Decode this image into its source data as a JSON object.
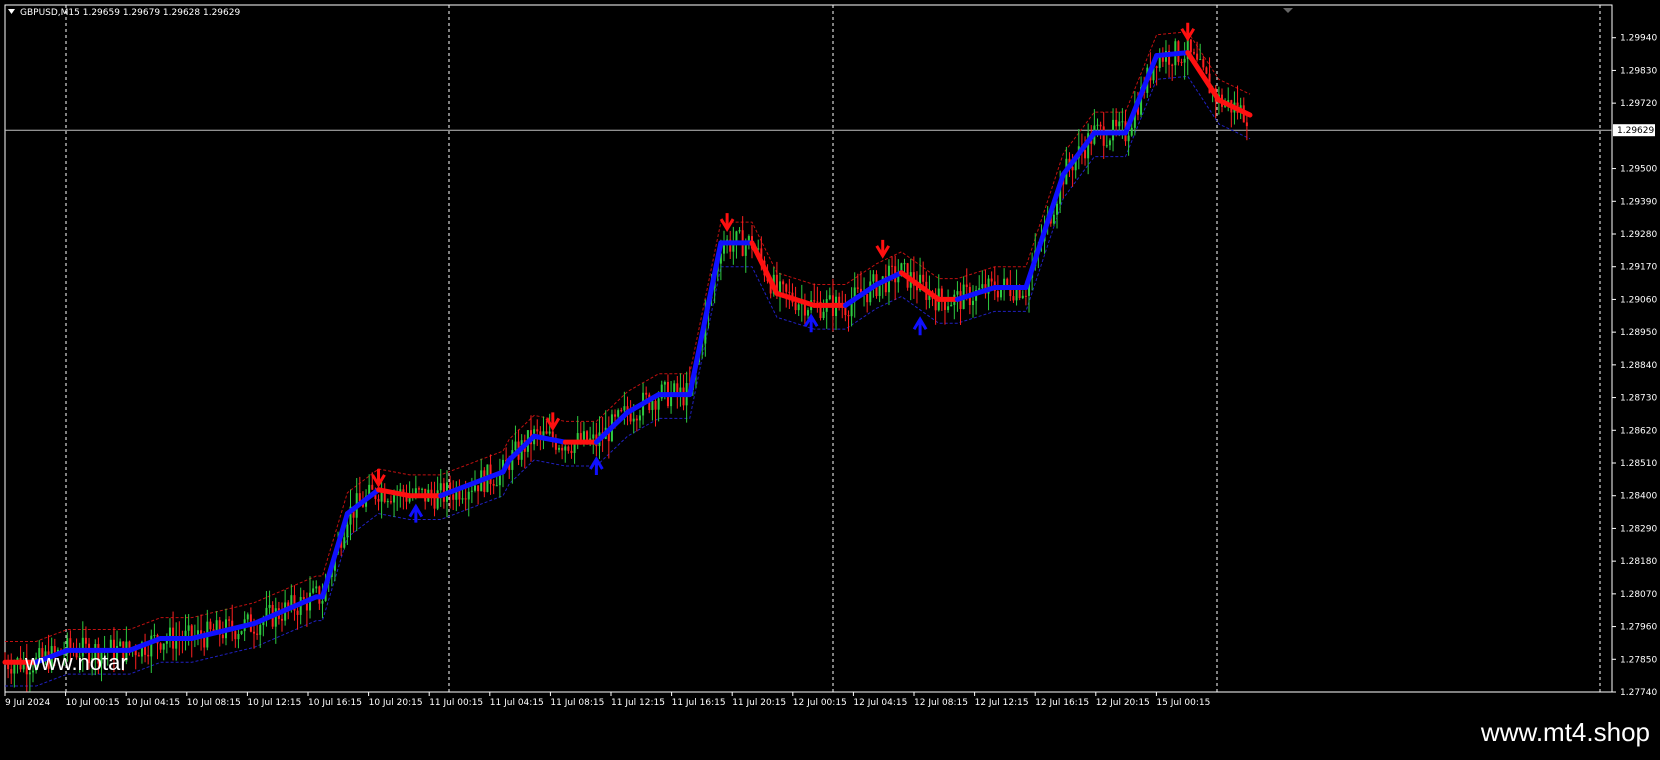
{
  "header": {
    "symbol_info": "GBPUSD,M15  1.29659 1.29679 1.29628 1.29629"
  },
  "watermarks": {
    "chart": "www.notar",
    "footer": "www.mt4.shop"
  },
  "current_price_label": "1.29629",
  "colors": {
    "background": "#000000",
    "frame": "#ffffff",
    "bull_candle": "#2ecc40",
    "bear_candle": "#ff2020",
    "trend_up": "#1010ff",
    "trend_down": "#ff1010",
    "band_upper": "#c01010",
    "band_lower": "#2020c0",
    "price_line": "#c0c0c0",
    "grid": "#ffffff"
  },
  "chart_data": {
    "type": "line",
    "symbol": "GBPUSD",
    "timeframe": "M15",
    "ylim": [
      1.2774,
      1.3005
    ],
    "y_ticks": [
      "1.29940",
      "1.29830",
      "1.29720",
      "1.29500",
      "1.29390",
      "1.29280",
      "1.29170",
      "1.29060",
      "1.28950",
      "1.28840",
      "1.28730",
      "1.28620",
      "1.28510",
      "1.28400",
      "1.28290",
      "1.28180",
      "1.28070",
      "1.27960",
      "1.27850",
      "1.27740"
    ],
    "x_ticks": [
      "9 Jul 2024",
      "10 Jul 00:15",
      "10 Jul 04:15",
      "10 Jul 08:15",
      "10 Jul 12:15",
      "10 Jul 16:15",
      "10 Jul 20:15",
      "11 Jul 00:15",
      "11 Jul 04:15",
      "11 Jul 08:15",
      "11 Jul 12:15",
      "11 Jul 16:15",
      "11 Jul 20:15",
      "12 Jul 00:15",
      "12 Jul 04:15",
      "12 Jul 08:15",
      "12 Jul 12:15",
      "12 Jul 16:15",
      "12 Jul 20:15",
      "15 Jul 00:15"
    ],
    "current_price": 1.29629,
    "day_separators": [
      0.5,
      6.5,
      12.5,
      18.5
    ],
    "trend_line": {
      "x": [
        0,
        0.5,
        1,
        2,
        2.5,
        3,
        4,
        5,
        5.1,
        5.5,
        6,
        6.5,
        7,
        8,
        8.1,
        8.5,
        9,
        9.5,
        10,
        10.5,
        11,
        11.5,
        12,
        12.4,
        13,
        13.5,
        14,
        14.4,
        15,
        15.3,
        15.9,
        16.4,
        17,
        17.5,
        18,
        18.5,
        19,
        19.5,
        20
      ],
      "y": [
        1.2784,
        1.2784,
        1.2788,
        1.2788,
        1.2792,
        1.2792,
        1.2797,
        1.2806,
        1.2806,
        1.2834,
        1.2842,
        1.284,
        1.284,
        1.2848,
        1.2852,
        1.286,
        1.2858,
        1.2858,
        1.2868,
        1.2874,
        1.2874,
        1.2925,
        1.2925,
        1.2908,
        1.2904,
        1.2904,
        1.2911,
        1.2915,
        1.2906,
        1.2906,
        1.291,
        1.291,
        1.2948,
        1.2962,
        1.2962,
        1.2988,
        1.2989,
        1.2973,
        1.2968
      ],
      "dir": [
        "down",
        "up",
        "up",
        "up",
        "up",
        "up",
        "up",
        "up",
        "up",
        "up",
        "down",
        "down",
        "up",
        "up",
        "up",
        "up",
        "down",
        "up",
        "up",
        "up",
        "up",
        "up",
        "down",
        "down",
        "down",
        "up",
        "up",
        "down",
        "down",
        "up",
        "up",
        "up",
        "up",
        "up",
        "up",
        "up",
        "down",
        "down",
        "down"
      ]
    },
    "arrows": [
      {
        "x": 6.0,
        "y": 1.2845,
        "dir": "down"
      },
      {
        "x": 6.6,
        "y": 1.2835,
        "dir": "up"
      },
      {
        "x": 8.8,
        "y": 1.2864,
        "dir": "down"
      },
      {
        "x": 9.5,
        "y": 1.2851,
        "dir": "up"
      },
      {
        "x": 11.6,
        "y": 1.2931,
        "dir": "down"
      },
      {
        "x": 12.95,
        "y": 1.2899,
        "dir": "up"
      },
      {
        "x": 14.1,
        "y": 1.2922,
        "dir": "down"
      },
      {
        "x": 14.7,
        "y": 1.2898,
        "dir": "up"
      },
      {
        "x": 19.0,
        "y": 1.2995,
        "dir": "down"
      }
    ]
  }
}
